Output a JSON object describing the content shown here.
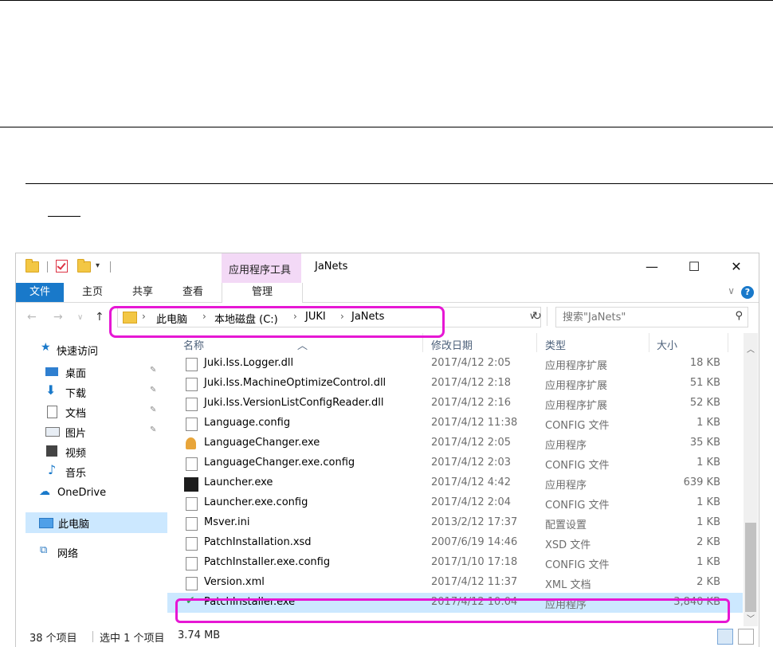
{
  "window": {
    "title": "JaNets",
    "context_tab_group": "应用程序工具",
    "controls": {
      "minimize": "—",
      "maximize": "☐",
      "close": "✕"
    }
  },
  "ribbon": {
    "tabs": [
      "文件",
      "主页",
      "共享",
      "查看",
      "管理"
    ],
    "help": "?"
  },
  "address": {
    "breadcrumbs": [
      "此电脑",
      "本地磁盘 (C:)",
      "JUKI",
      "JaNets"
    ],
    "search_placeholder": "搜索\"JaNets\""
  },
  "nav_pane": [
    {
      "label": "快速访问",
      "icon": "star-icon"
    },
    {
      "label": "桌面",
      "icon": "desktop-icon",
      "pinned": true
    },
    {
      "label": "下载",
      "icon": "download-icon",
      "pinned": true
    },
    {
      "label": "文档",
      "icon": "document-icon",
      "pinned": true
    },
    {
      "label": "图片",
      "icon": "picture-icon",
      "pinned": true
    },
    {
      "label": "视频",
      "icon": "video-icon"
    },
    {
      "label": "音乐",
      "icon": "music-icon"
    },
    {
      "label": "OneDrive",
      "icon": "cloud-icon"
    },
    {
      "label": "此电脑",
      "icon": "computer-icon",
      "selected": true
    },
    {
      "label": "网络",
      "icon": "network-icon"
    }
  ],
  "columns": {
    "name": "名称",
    "date": "修改日期",
    "type": "类型",
    "size": "大小"
  },
  "files": [
    {
      "name": "Juki.Iss.Logger.dll",
      "date": "2017/4/12 2:05",
      "type": "应用程序扩展",
      "size": "18 KB"
    },
    {
      "name": "Juki.Iss.MachineOptimizeControl.dll",
      "date": "2017/4/12 2:18",
      "type": "应用程序扩展",
      "size": "51 KB"
    },
    {
      "name": "Juki.Iss.VersionListConfigReader.dll",
      "date": "2017/4/12 2:16",
      "type": "应用程序扩展",
      "size": "52 KB"
    },
    {
      "name": "Language.config",
      "date": "2017/4/12 11:38",
      "type": "CONFIG 文件",
      "size": "1 KB"
    },
    {
      "name": "LanguageChanger.exe",
      "date": "2017/4/12 2:05",
      "type": "应用程序",
      "size": "35 KB"
    },
    {
      "name": "LanguageChanger.exe.config",
      "date": "2017/4/12 2:03",
      "type": "CONFIG 文件",
      "size": "1 KB"
    },
    {
      "name": "Launcher.exe",
      "date": "2017/4/12 4:42",
      "type": "应用程序",
      "size": "639 KB"
    },
    {
      "name": "Launcher.exe.config",
      "date": "2017/4/12 2:04",
      "type": "CONFIG 文件",
      "size": "1 KB"
    },
    {
      "name": "Msver.ini",
      "date": "2013/2/12 17:37",
      "type": "配置设置",
      "size": "1 KB"
    },
    {
      "name": "PatchInstallation.xsd",
      "date": "2007/6/19 14:46",
      "type": "XSD 文件",
      "size": "2 KB"
    },
    {
      "name": "PatchInstaller.exe.config",
      "date": "2017/1/10 17:18",
      "type": "CONFIG 文件",
      "size": "1 KB"
    },
    {
      "name": "Version.xml",
      "date": "2017/4/12 11:37",
      "type": "XML 文档",
      "size": "2 KB"
    },
    {
      "name": "PatchInstaller.exe",
      "date": "2017/4/12 10:04",
      "type": "应用程序",
      "size": "3,840 KB",
      "selected": true
    }
  ],
  "status": {
    "count": "38 个项目",
    "selection": "选中 1 个项目",
    "size": "3.74 MB"
  },
  "colors": {
    "accent": "#1979ca",
    "highlight": "#e617d4",
    "selection": "#cce8ff",
    "context_tab": "#f3d9f6"
  }
}
